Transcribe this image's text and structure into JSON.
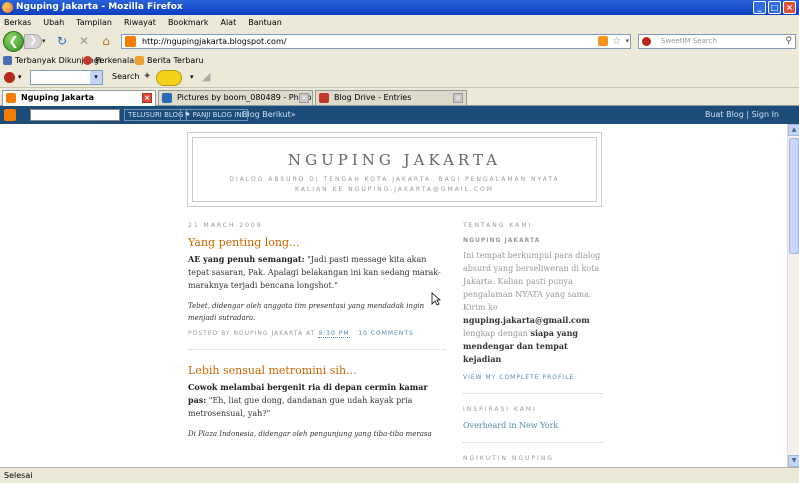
{
  "window": {
    "title": "Nguping Jakarta - Mozilla Firefox",
    "btn_min": "_",
    "btn_max": "□",
    "btn_close": "×"
  },
  "menu": [
    "Berkas",
    "Ubah",
    "Tampilan",
    "Riwayat",
    "Bookmark",
    "Alat",
    "Bantuan"
  ],
  "nav": {
    "back": "❮",
    "forward": "❯",
    "dropdown": "▾",
    "reload": "↻",
    "stop": "✕",
    "home": "⌂",
    "url": "http://ngupingjakarta.blogspot.com/",
    "search_placeholder": "SweetIM Search",
    "search_glyph": "⚲"
  },
  "bookmarks": [
    {
      "label": "Terbanyak Dikunjungi",
      "color": "#4a6fb5"
    },
    {
      "label": "Perkenalan",
      "color": "#c0392b"
    },
    {
      "label": "Berita Terbaru",
      "color": "#f0a030"
    }
  ],
  "toolbar": {
    "search_label": "Search",
    "combo_arrow": "▾"
  },
  "tabs": [
    {
      "label": "Nguping Jakarta",
      "color": "#f57d00",
      "active": true
    },
    {
      "label": "Pictures by boom_080489 - Photobucket",
      "color": "#2a6bb8",
      "active": false
    },
    {
      "label": "Blog Drive - Entries",
      "color": "#c0392b",
      "active": false
    }
  ],
  "tab_close": "×",
  "blogger_bar": {
    "search_button": "TELUSURI BLOG",
    "flag_button": "⚑ PANJI BLOG INI",
    "next_blog": "Blog Berikut»",
    "create_blog": "Buat Blog",
    "separator": "|",
    "sign_in": "Sign In"
  },
  "blog": {
    "title": "NGUPING JAKARTA",
    "description": "Dialog absurd di tengah kota Jakarta. Bagi pengalaman NYATA kalian ke nguping.jakarta@gmail.com"
  },
  "posts": [
    {
      "date": "21 March 2009",
      "title": "Yang penting long...",
      "speaker": "AE yang penuh semangat:",
      "quote": " \"Jadi pasti message kita akan tepat sasaran, Pak. Apalagi belakangan ini kan sedang marak-maraknya terjadi bencana longshot.\"",
      "context": "Tebet, didengar oleh anggota tim presentasi yang mendadak ingin menjadi sutradara.",
      "footer_prefix": "Posted by Nguping Jakarta at",
      "time": "9:30 PM",
      "comments": "10 comments"
    },
    {
      "title": "Lebih sensual metromini sih...",
      "speaker": "Cowok melambai bergenit ria di depan cermin kamar pas:",
      "quote": " \"Eh, liat gue dong, dandanan gue udah kayak pria metrosensual, yah?\"",
      "context": "Di Plaza Indonesia, didengar oleh pengunjung yang tiba-tiba merasa"
    }
  ],
  "sidebar": {
    "about_heading": "Tentang Kami",
    "about_name": "NGUPING JAKARTA",
    "about_text": "Ini tempat berkumpul para dialog absurd yang berseliweran di kota Jakarta. Kalian pasti punya pengalaman NYATA yang sama. Kirim ke",
    "about_email": "nguping.jakarta@gmail.com",
    "about_text2": "lengkap dengan",
    "about_bold": "siapa yang mendengar dan tempat kejadian",
    "profile_link": "View my complete profile",
    "inspirasi_heading": "Inspirasi Kami",
    "inspirasi_link": "Overheard in New York",
    "follow_heading": "Ngikutin Nguping"
  },
  "status": "Selesai",
  "scrollbar": {
    "up": "▲",
    "down": "▼"
  }
}
